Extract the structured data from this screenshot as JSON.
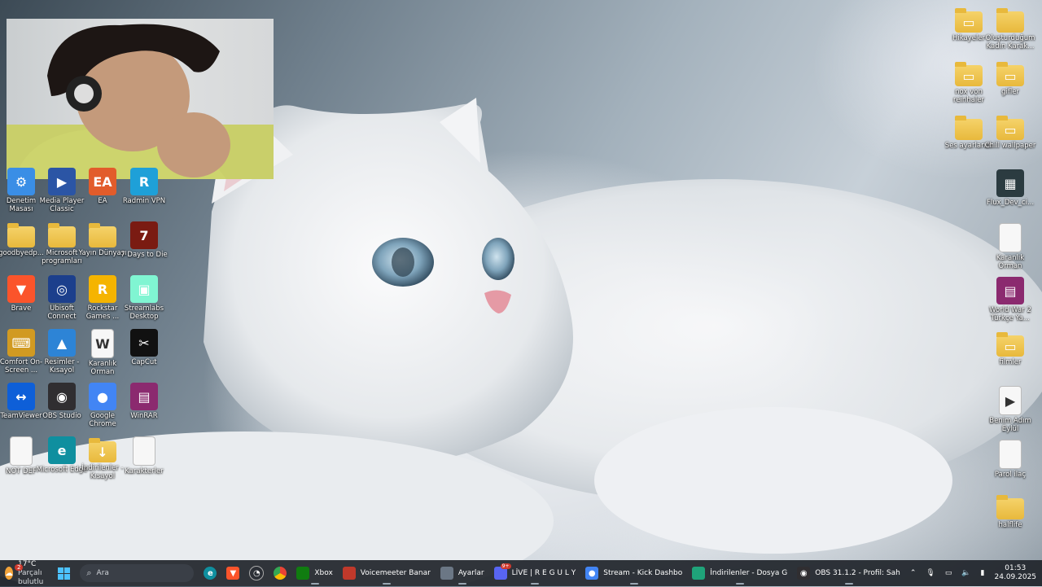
{
  "desktop_icons": {
    "left": [
      {
        "id": "denetim",
        "label": "Denetim Masası",
        "icon": "control-panel-icon",
        "color": "#3a8ee6"
      },
      {
        "id": "mpc",
        "label": "Media Player Classic",
        "icon": "media-player-icon",
        "color": "#2b55a5"
      },
      {
        "id": "ea",
        "label": "EA",
        "icon": "ea-icon",
        "color": "#e25c2b"
      },
      {
        "id": "radmin",
        "label": "Radmin VPN",
        "icon": "radmin-icon",
        "color": "#1ea0d8"
      },
      {
        "id": "goodbye",
        "label": "goodbyedp...",
        "icon": "folder-icon",
        "color": "#f0c64f"
      },
      {
        "id": "msprog",
        "label": "Microsoft programları",
        "icon": "folder-icon",
        "color": "#f0c64f"
      },
      {
        "id": "yayin",
        "label": "Yayın Dünyası",
        "icon": "folder-icon",
        "color": "#f0c64f"
      },
      {
        "id": "7days",
        "label": "7 Days to Die",
        "icon": "game-7days-icon",
        "color": "#7a1b12"
      },
      {
        "id": "brave",
        "label": "Brave",
        "icon": "brave-icon",
        "color": "#fb542b"
      },
      {
        "id": "ubisoft",
        "label": "Ubisoft Connect",
        "icon": "ubisoft-icon",
        "color": "#1c3f8c"
      },
      {
        "id": "rockstar",
        "label": "Rockstar Games ...",
        "icon": "rockstar-icon",
        "color": "#f5b400"
      },
      {
        "id": "streamlabs",
        "label": "Streamlabs Desktop",
        "icon": "streamlabs-icon",
        "color": "#80f5d2"
      },
      {
        "id": "osk",
        "label": "Comfort On-Screen ...",
        "icon": "keyboard-icon",
        "color": "#d19a22"
      },
      {
        "id": "resimler",
        "label": "Resimler - Kısayol",
        "icon": "pictures-icon",
        "color": "#2d84d6"
      },
      {
        "id": "karanlik1",
        "label": "Karanlık Orman",
        "icon": "word-doc-icon",
        "color": "#f7f7f7"
      },
      {
        "id": "capcut",
        "label": "CapCut",
        "icon": "capcut-icon",
        "color": "#111111"
      },
      {
        "id": "teamviewer",
        "label": "TeamViewer",
        "icon": "teamviewer-icon",
        "color": "#0e5fd8"
      },
      {
        "id": "obs",
        "label": "OBS Studio",
        "icon": "obs-icon",
        "color": "#302e31"
      },
      {
        "id": "chrome",
        "label": "Google Chrome",
        "icon": "chrome-icon",
        "color": "#4285f4"
      },
      {
        "id": "winrar",
        "label": "WinRAR",
        "icon": "winrar-icon",
        "color": "#8b2a6f"
      },
      {
        "id": "notdef",
        "label": "NOT DEF",
        "icon": "text-file-icon",
        "color": "#f7f7f7"
      },
      {
        "id": "edge",
        "label": "Microsoft Edge",
        "icon": "edge-icon",
        "color": "#0f8f9f"
      },
      {
        "id": "indirilenler",
        "label": "İndirilenler - Kısayol",
        "icon": "download-folder-icon",
        "color": "#1fa37a"
      },
      {
        "id": "karakterler",
        "label": "Karakterler",
        "icon": "text-file-icon",
        "color": "#f7f7f7"
      }
    ],
    "right": [
      {
        "id": "hikayeler",
        "label": "Hikayeler",
        "icon": "image-folder-icon",
        "color": "#f0c64f"
      },
      {
        "id": "olusturdugum",
        "label": "Oluşturduğum Kadın Karak...",
        "icon": "folder-icon",
        "color": "#f0c64f"
      },
      {
        "id": "noxvon",
        "label": "nox von reinhaler",
        "icon": "image-folder-icon",
        "color": "#f0c64f"
      },
      {
        "id": "gifler",
        "label": "gifler",
        "icon": "image-folder-icon",
        "color": "#f0c64f"
      },
      {
        "id": "ses",
        "label": "Ses ayarlarım",
        "icon": "folder-icon",
        "color": "#f0c64f"
      },
      {
        "id": "chill",
        "label": "Chill wallpaper",
        "icon": "image-folder-icon",
        "color": "#f0c64f"
      },
      {
        "id": "flux",
        "label": "Flux_Dev_ci...",
        "icon": "image-thumb-icon",
        "color": "#2b3b40"
      },
      {
        "id": "karanlik2",
        "label": "Karanlık Orman",
        "icon": "text-file-icon",
        "color": "#f7f7f7"
      },
      {
        "id": "ww2",
        "label": "World War 2 Türkçe Ya...",
        "icon": "winrar-icon",
        "color": "#8b2a6f"
      },
      {
        "id": "filmler",
        "label": "filmler",
        "icon": "image-folder-icon",
        "color": "#f0c64f"
      },
      {
        "id": "benimadim",
        "label": "Benim Adım Eylül",
        "icon": "video-file-icon",
        "color": "#f7f7f7"
      },
      {
        "id": "parolilac",
        "label": "Parol ilaç",
        "icon": "text-file-icon",
        "color": "#f7f7f7"
      },
      {
        "id": "halflife",
        "label": "halflife",
        "icon": "folder-icon",
        "color": "#f0c64f"
      }
    ]
  },
  "taskbar": {
    "weather": {
      "temp": "17°C",
      "condition": "Parçalı bulutlu",
      "badge": "2"
    },
    "search_placeholder": "Ara",
    "apps": [
      {
        "id": "xbox",
        "label": "Xbox",
        "icon": "xbox-icon",
        "color": "#107c10"
      },
      {
        "id": "voicemeeter",
        "label": "Voicemeeter Banar",
        "icon": "voicemeeter-icon",
        "color": "#c0392b"
      },
      {
        "id": "ayarlar",
        "label": "Ayarlar",
        "icon": "gear-icon",
        "color": "#6b7785"
      },
      {
        "id": "discord",
        "label": "LİVE | R E G U L Y",
        "icon": "discord-icon",
        "color": "#5865f2",
        "badge": "9+"
      },
      {
        "id": "chromekick",
        "label": "Stream - Kick Dashbo",
        "icon": "chrome-icon",
        "color": "#4285f4"
      },
      {
        "id": "explorer",
        "label": "İndirilenler - Dosya G",
        "icon": "download-icon",
        "color": "#1fa37a"
      },
      {
        "id": "obs",
        "label": "OBS 31.1.2 - Profil: Sah",
        "icon": "obs-icon",
        "color": "#302e31"
      }
    ],
    "clock": {
      "time": "01:53",
      "date": "24.09.2025"
    }
  }
}
